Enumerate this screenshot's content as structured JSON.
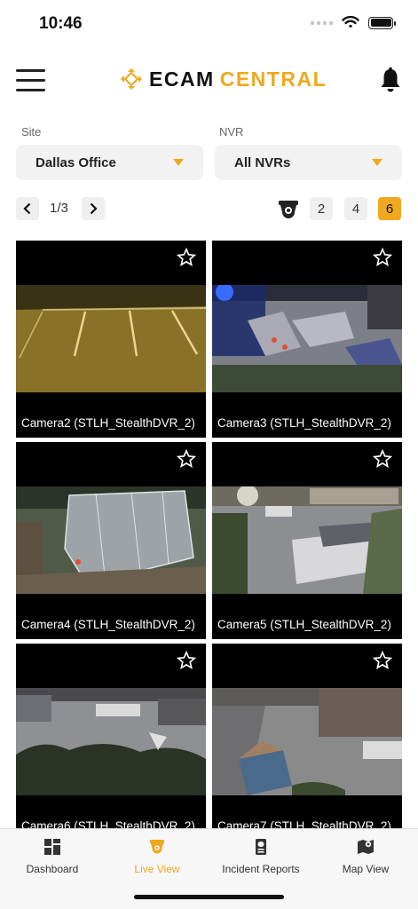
{
  "status_bar": {
    "time": "10:46"
  },
  "header": {
    "logo_part1": "ECAM",
    "logo_part2": "CENTRAL"
  },
  "filters": {
    "site_label": "Site",
    "site_value": "Dallas Office",
    "nvr_label": "NVR",
    "nvr_value": "All NVRs"
  },
  "pager": {
    "page_text": "1/3",
    "grid_options": [
      "2",
      "4",
      "6"
    ],
    "selected_grid": "6"
  },
  "cameras": [
    {
      "name": "Camera2 (STLH_StealthDVR_2)"
    },
    {
      "name": "Camera3 (STLH_StealthDVR_2)"
    },
    {
      "name": "Camera4 (STLH_StealthDVR_2)"
    },
    {
      "name": "Camera5 (STLH_StealthDVR_2)"
    },
    {
      "name": "Camera6 (STLH_StealthDVR_2)"
    },
    {
      "name": "Camera7 (STLH_StealthDVR_2)"
    }
  ],
  "tabs": [
    {
      "label": "Dashboard",
      "icon": "dashboard-icon"
    },
    {
      "label": "Live View",
      "icon": "live-view-icon",
      "active": true
    },
    {
      "label": "Incident Reports",
      "icon": "incident-reports-icon"
    },
    {
      "label": "Map View",
      "icon": "map-view-icon"
    }
  ],
  "colors": {
    "accent": "#f0a81c",
    "tile_bg": "#000000"
  }
}
